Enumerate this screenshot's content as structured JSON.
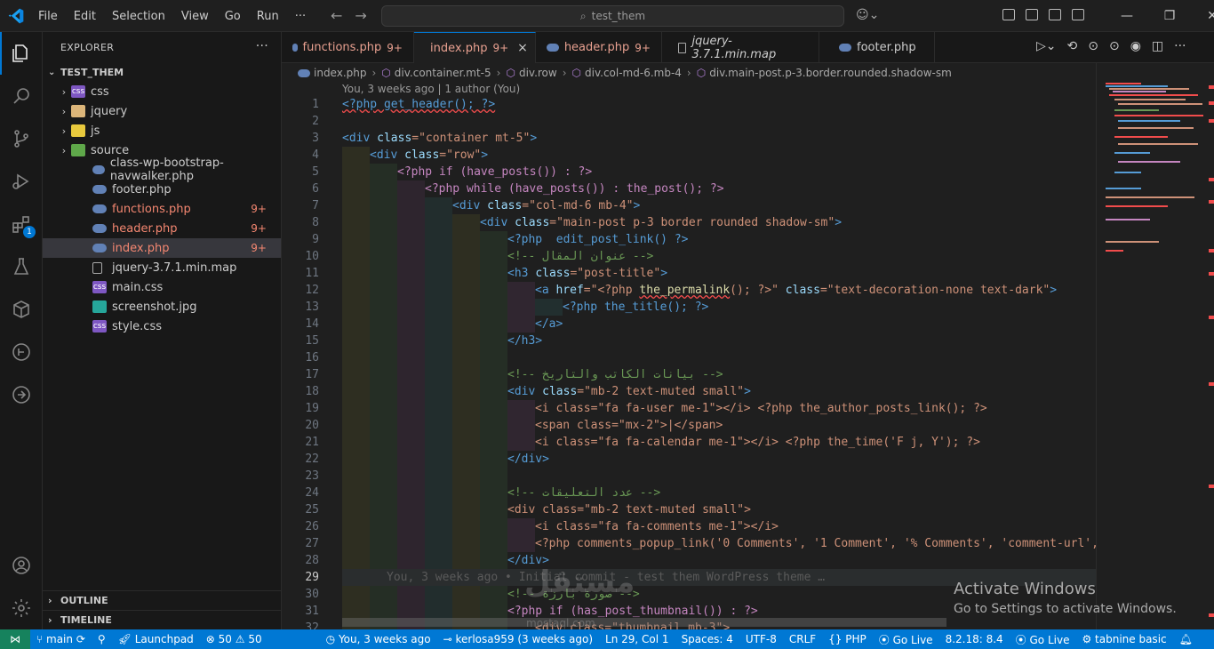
{
  "menu": [
    "File",
    "Edit",
    "Selection",
    "View",
    "Go",
    "Run",
    "···"
  ],
  "search": {
    "text": "test_them"
  },
  "explorer": {
    "title": "EXPLORER",
    "root": "TEST_THEM",
    "items": [
      {
        "label": "css",
        "type": "folder",
        "icon": "css"
      },
      {
        "label": "jquery",
        "type": "folder",
        "icon": "folder"
      },
      {
        "label": "js",
        "type": "folder",
        "icon": "folder"
      },
      {
        "label": "source",
        "type": "folder",
        "icon": "folder"
      },
      {
        "label": "class-wp-bootstrap-navwalker.php",
        "type": "php"
      },
      {
        "label": "footer.php",
        "type": "php"
      },
      {
        "label": "functions.php",
        "type": "php",
        "count": "9+",
        "modified": true
      },
      {
        "label": "header.php",
        "type": "php",
        "count": "9+",
        "modified": true
      },
      {
        "label": "index.php",
        "type": "php",
        "count": "9+",
        "modified": true,
        "selected": true
      },
      {
        "label": "jquery-3.7.1.min.map",
        "type": "map"
      },
      {
        "label": "main.css",
        "type": "css"
      },
      {
        "label": "screenshot.jpg",
        "type": "img"
      },
      {
        "label": "style.css",
        "type": "css"
      }
    ],
    "outline": "OUTLINE",
    "timeline": "TIMELINE"
  },
  "activity_badge": "1",
  "tabs": [
    {
      "label": "functions.php",
      "count": "9+"
    },
    {
      "label": "index.php",
      "count": "9+",
      "active": true,
      "close": "×"
    },
    {
      "label": "header.php",
      "count": "9+"
    },
    {
      "label": "jquery-3.7.1.min.map",
      "count": ""
    },
    {
      "label": "footer.php",
      "count": ""
    }
  ],
  "breadcrumb": [
    "index.php",
    "div.container.mt-5",
    "div.row",
    "div.col-md-6.mb-4",
    "div.main-post.p-3.border.rounded.shadow-sm"
  ],
  "blame": "You, 3 weeks ago | 1 author (You)",
  "code_lines": [
    "1",
    "2",
    "3",
    "4",
    "5",
    "6",
    "7",
    "8",
    "9",
    "10",
    "11",
    "12",
    "13",
    "14",
    "15",
    "16",
    "17",
    "18",
    "19",
    "20",
    "21",
    "22",
    "23",
    "24",
    "25",
    "26",
    "27",
    "28",
    "29",
    "30",
    "31",
    "32"
  ],
  "code": {
    "l1": "<?php get_header(); ?>",
    "l3a": "<div ",
    "l3b": "class",
    "l3c": "=\"container mt-5\"",
    "l3d": ">",
    "l4a": "<div ",
    "l4b": "class",
    "l4c": "=\"row\"",
    "l4d": ">",
    "l5": "<?php if (have_posts()) : ?>",
    "l6": "<?php while (have_posts()) : the_post(); ?>",
    "l7a": "<div ",
    "l7b": "class",
    "l7c": "=\"col-md-6 mb-4\"",
    "l7d": ">",
    "l8a": "<div ",
    "l8b": "class",
    "l8c": "=\"main-post p-3 border rounded shadow-sm\"",
    "l8d": ">",
    "l9": "<?php  edit_post_link() ?>",
    "l10": "<!-- عنوان المقال -->",
    "l11a": "<h3 ",
    "l11b": "class",
    "l11c": "=\"post-title\"",
    "l11d": ">",
    "l12a": "<a ",
    "l12b": "href",
    "l12c": "=\"<?php ",
    "l12d": "the_permalink",
    "l12e": "(); ?>\"",
    "l12f": " class",
    "l12g": "=\"text-decoration-none text-dark\"",
    "l12h": ">",
    "l13": "<?php the_title(); ?>",
    "l14": "</a>",
    "l15": "</h3>",
    "l17": "<!-- بيانات الكاتب والتاريخ -->",
    "l18a": "<div ",
    "l18b": "class",
    "l18c": "=\"mb-2 text-muted small\"",
    "l18d": ">",
    "l19": "<i class=\"fa fa-user me-1\"></i> <?php the_author_posts_link(); ?>",
    "l20": "<span class=\"mx-2\">|</span>",
    "l21": "<i class=\"fa fa-calendar me-1\"></i> <?php the_time('F j, Y'); ?>",
    "l22": "</div>",
    "l24": "<!-- عدد التعليقات -->",
    "l25": "<div class=\"mb-2 text-muted small\">",
    "l26": "<i class=\"fa fa-comments me-1\"></i>",
    "l27": "<?php comments_popup_link('0 Comments', '1 Comment', '% Comments', 'comment-url',",
    "l28": "</div>",
    "l29_ghost": "You, 3 weeks ago • Initial commit - test them WordPress theme …",
    "l30": "<!-- صورة بارزة -->",
    "l31": "<?php if (has_post_thumbnail()) : ?>",
    "l32": "<div class=\"thumbnail mb-3\">"
  },
  "activate": {
    "title": "Activate Windows",
    "sub": "Go to Settings to activate Windows."
  },
  "watermark": {
    "main": "مستقل",
    "sub": "mostaql.com"
  },
  "status": {
    "branch": "main",
    "launchpad": "Launchpad",
    "errors": "50",
    "warnings": "50",
    "blame": "You, 3 weeks ago",
    "author": "kerlosa959 (3 weeks ago)",
    "position": "Ln 29, Col 1",
    "spaces": "Spaces: 4",
    "encoding": "UTF-8",
    "eol": "CRLF",
    "language": "PHP",
    "golive1": "Go Live",
    "php_version": "8.2.18: 8.4",
    "golive2": "Go Live",
    "tabnine": "tabnine basic"
  }
}
